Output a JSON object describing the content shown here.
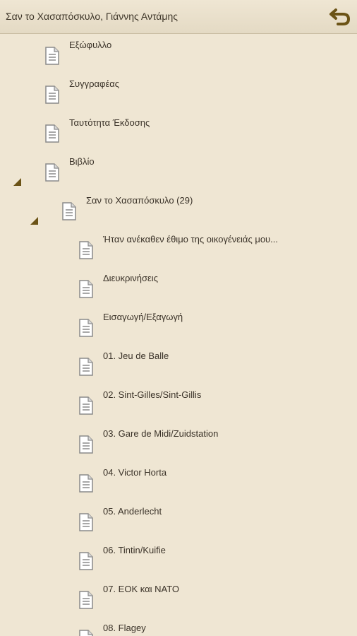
{
  "header": {
    "title": "Σαν το Χασαπόσκυλο, Γιάννης Αντάμης",
    "back_icon": "back-arrow-icon"
  },
  "toc": {
    "items": [
      {
        "label": "Εξώφυλλο",
        "level": 0,
        "expanded": null
      },
      {
        "label": "Συγγραφέας",
        "level": 0,
        "expanded": null
      },
      {
        "label": "Ταυτότητα Έκδοσης",
        "level": 0,
        "expanded": null
      },
      {
        "label": "Βιβλίο",
        "level": 0,
        "expanded": true
      },
      {
        "label": "Σαν το Χασαπόσκυλο (29)",
        "level": 1,
        "expanded": true
      },
      {
        "label": "Ήταν ανέκαθεν έθιμο της οικογένειάς μου...",
        "level": 2,
        "expanded": null
      },
      {
        "label": "Διευκρινήσεις",
        "level": 2,
        "expanded": null
      },
      {
        "label": "Εισαγωγή/Εξαγωγή",
        "level": 2,
        "expanded": null
      },
      {
        "label": "01. Jeu de Balle",
        "level": 2,
        "expanded": null
      },
      {
        "label": "02. Sint-Gilles/Sint-Gillis",
        "level": 2,
        "expanded": null
      },
      {
        "label": "03. Gare de Midi/Zuidstation",
        "level": 2,
        "expanded": null
      },
      {
        "label": "04. Victor Horta",
        "level": 2,
        "expanded": null
      },
      {
        "label": "05. Anderlecht",
        "level": 2,
        "expanded": null
      },
      {
        "label": "06. Tintin/Kuifie",
        "level": 2,
        "expanded": null
      },
      {
        "label": "07. ΕΟΚ και ΝΑΤΟ",
        "level": 2,
        "expanded": null
      },
      {
        "label": "08. Flagey",
        "level": 2,
        "expanded": null
      }
    ]
  },
  "colors": {
    "background": "#efe6d3",
    "accent": "#6b5316",
    "text": "#3a3228",
    "icon": "#8a8a8a"
  }
}
